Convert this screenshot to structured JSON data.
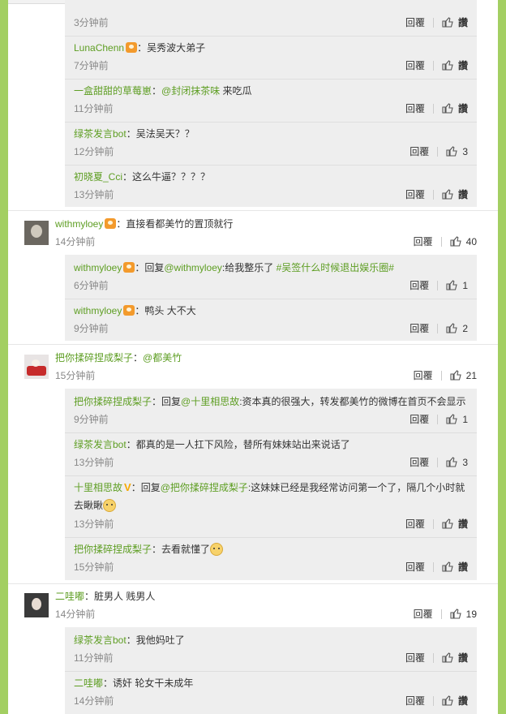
{
  "ui": {
    "reply_label": "回覆",
    "like_label": "讚"
  },
  "threads": [
    {
      "replies": [
        {
          "time": "3分钟前",
          "like": "讚"
        },
        {
          "user": "LunaChenn",
          "sep": "：",
          "text": "吴秀波大弟子",
          "time": "7分钟前",
          "like": "讚"
        },
        {
          "user": "一盒甜甜的草莓崽",
          "sep": "：",
          "at": "@封闭抹茶味",
          "text": " 来吃瓜",
          "time": "11分钟前",
          "like": "讚"
        },
        {
          "user": "绿茶发言bot",
          "sep": "：",
          "text": "吴法吴天？？",
          "time": "12分钟前",
          "like": "3"
        },
        {
          "user": "初晓夏_Cci",
          "sep": "：",
          "text": "这么牛逼？？？？",
          "time": "13分钟前",
          "like": "讚"
        }
      ]
    },
    {
      "comment": {
        "user": "withmyloey",
        "sep": "：",
        "text": "直接看都美竹的置顶就行",
        "time": "14分钟前",
        "like": "40"
      },
      "replies": [
        {
          "user": "withmyloey",
          "sep": "：回复",
          "at": "@withmyloey",
          "text": ":给我整乐了 ",
          "tag": "#吴签什么时候退出娱乐圈#",
          "time": "6分钟前",
          "like": "1"
        },
        {
          "user": "withmyloey",
          "sep": "：",
          "text": "鸭头 大不大",
          "time": "9分钟前",
          "like": "2"
        }
      ]
    },
    {
      "comment": {
        "user": "把你揉碎捏成梨子",
        "sep": "：",
        "at": "@都美竹",
        "time": "15分钟前",
        "like": "21"
      },
      "replies": [
        {
          "user": "把你揉碎捏成梨子",
          "sep": "：回复",
          "at": "@十里相思故",
          "text": ":资本真的很强大，转发都美竹的微博在首页不会显示",
          "time": "9分钟前",
          "like": "1"
        },
        {
          "user": "绿茶发言bot",
          "sep": "：",
          "text": "都真的是一人扛下风险，替所有妹妹站出来说话了",
          "time": "13分钟前",
          "like": "3"
        },
        {
          "user": "十里相思故",
          "vbadge": "V",
          "sep": "：回复",
          "at": "@把你揉碎捏成梨子",
          "text": ":这妹妹已经是我经常访问第一个了，隔几个小时就",
          "text2": "去瞅瞅",
          "time": "13分钟前",
          "like": "讚"
        },
        {
          "user": "把你揉碎捏成梨子",
          "sep": "：",
          "text": "去看就懂了",
          "time": "15分钟前",
          "like": "讚"
        }
      ]
    },
    {
      "comment": {
        "user": "二哇嘟",
        "sep": "：",
        "text": "脏男人 贱男人",
        "time": "14分钟前",
        "like": "19"
      },
      "replies": [
        {
          "user": "绿茶发言bot",
          "sep": "：",
          "text": "我他妈吐了",
          "time": "11分钟前",
          "like": "讚"
        },
        {
          "user": "二哇嘟",
          "sep": "：",
          "text": "诱奸 轮女干未成年",
          "time": "14分钟前",
          "like": "讚"
        }
      ]
    }
  ]
}
